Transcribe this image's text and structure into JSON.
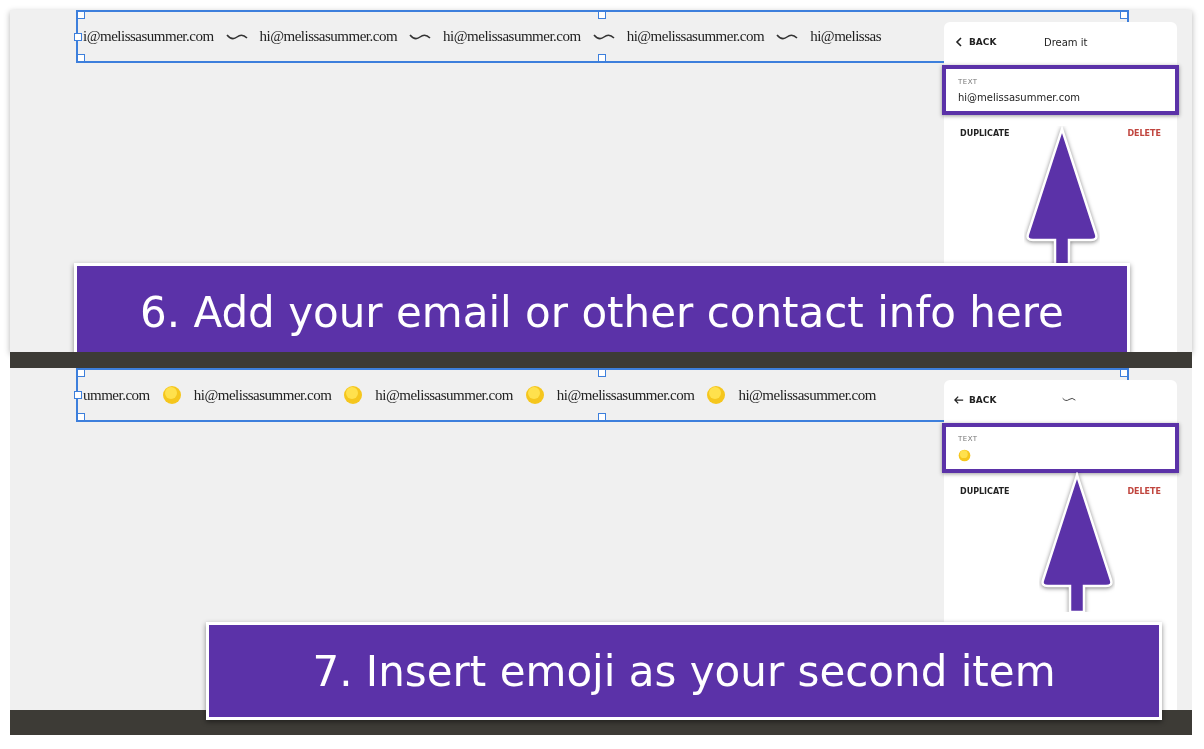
{
  "steps": [
    {
      "kind": "plain",
      "ticker": {
        "items": [
          {
            "kind": "text",
            "text": "i@melissasummer.com"
          },
          {
            "kind": "wave"
          },
          {
            "kind": "text",
            "text": "hi@melissasummer.com"
          },
          {
            "kind": "wave"
          },
          {
            "kind": "text",
            "text": "hi@melissasummer.com"
          },
          {
            "kind": "wave"
          },
          {
            "kind": "text",
            "text": "hi@melissasummer.com"
          },
          {
            "kind": "wave"
          },
          {
            "kind": "text",
            "text": "hi@melissas"
          }
        ]
      },
      "editor": {
        "back": {
          "kind": "chevron",
          "label": "BACK"
        },
        "title": {
          "kind": "text",
          "text": "Dream it"
        },
        "field": {
          "label": "TEXT",
          "value": {
            "kind": "text",
            "text": "hi@melissasummer.com"
          }
        },
        "duplicate": "DUPLICATE",
        "delete": "DELETE"
      },
      "callout": "6. Add your email or other contact info here"
    },
    {
      "kind": "dark-bars",
      "ticker": {
        "items": [
          {
            "kind": "text",
            "text": "ummer.com"
          },
          {
            "kind": "emoji"
          },
          {
            "kind": "text",
            "text": "hi@melissasummer.com"
          },
          {
            "kind": "emoji"
          },
          {
            "kind": "text",
            "text": "hi@melissasummer.com"
          },
          {
            "kind": "emoji"
          },
          {
            "kind": "text",
            "text": "hi@melissasummer.com"
          },
          {
            "kind": "emoji"
          },
          {
            "kind": "text",
            "text": "hi@melissasummer.com"
          }
        ]
      },
      "editor": {
        "back": {
          "kind": "arrow",
          "label": "BACK"
        },
        "title": {
          "kind": "wave"
        },
        "field": {
          "label": "TEXT",
          "value": {
            "kind": "emoji"
          }
        },
        "duplicate": "DUPLICATE",
        "delete": "DELETE"
      },
      "callout": "7. Insert emoji as your second item"
    }
  ]
}
